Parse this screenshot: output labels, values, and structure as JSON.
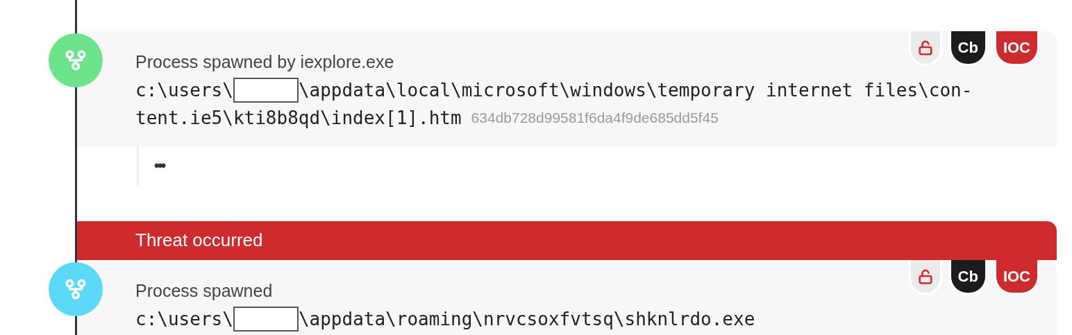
{
  "timeline": [
    {
      "kind": "process",
      "color": "#6de38b",
      "title": "Process spawned by iexplore.exe",
      "badges": [
        {
          "kind": "lock",
          "color": "#ebebeb"
        },
        {
          "kind": "text",
          "label": "Cb",
          "color": "#1c1c1c"
        },
        {
          "kind": "text",
          "label": "IOC",
          "color": "#cf2a2e"
        }
      ],
      "path_lines": [
        [
          {
            "kind": "text",
            "text": "c:\\users\\"
          },
          {
            "kind": "redacted"
          },
          {
            "kind": "text",
            "text": "\\appdata\\local\\microsoft\\windows\\temporary internet files\\con-"
          }
        ],
        [
          {
            "kind": "text",
            "text": "tent.ie5\\kti8b8qd\\index[1].htm"
          }
        ]
      ],
      "hash": "634db728d99581f6da4f9de685dd5f45",
      "more": "•••"
    },
    {
      "kind": "banner",
      "label": "Threat occurred"
    },
    {
      "kind": "process",
      "color": "#5cd9f8",
      "title": "Process spawned",
      "badges": [
        {
          "kind": "lock",
          "color": "#ebebeb"
        },
        {
          "kind": "text",
          "label": "Cb",
          "color": "#1c1c1c"
        },
        {
          "kind": "text",
          "label": "IOC",
          "color": "#cf2a2e"
        }
      ],
      "path_lines": [
        [
          {
            "kind": "text",
            "text": "c:\\users\\"
          },
          {
            "kind": "redacted"
          },
          {
            "kind": "text",
            "text": "\\appdata\\roaming\\nrvcsoxfvtsq\\shknlrdo.exe"
          }
        ]
      ]
    }
  ]
}
